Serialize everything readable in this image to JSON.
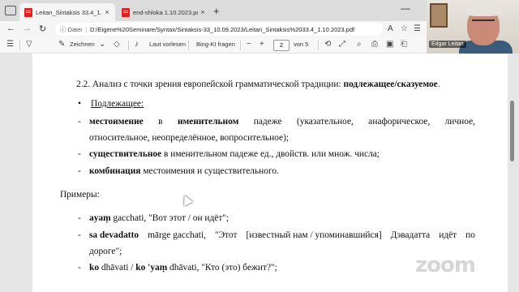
{
  "tabs": [
    {
      "title": "Leitan_Sintaksis 33.4_1.10.2023.p",
      "close": "×",
      "active": true
    },
    {
      "title": "end-shloka 1.10.2023.pdf",
      "close": "×",
      "active": false
    }
  ],
  "new_tab": "+",
  "minimize": "—",
  "nav": {
    "back": "←",
    "forward": "→",
    "reload": "↻"
  },
  "address": {
    "info": "ⓘ Datei",
    "url": "D:/Eigene%20Seminare/Syntax/Sintaksis-33_10.09.2023/Leitan_Sintaksis%2033.4_1.10.2023.pdf"
  },
  "pdf_toolbar": {
    "draw": "Zeichnen",
    "read_aloud": "Laut vorlesen",
    "bing": "Bing-KI fragen",
    "page_current": "2",
    "page_total": "von 5"
  },
  "document": {
    "heading_prefix": "2.2. Анализ с точки зрения европейской грамматической традиции: ",
    "heading_bold": "подлежащее/сказуемое",
    "heading_suffix": ".",
    "subject_bullet": "•",
    "subject_label": "Подлежащее:",
    "items": [
      {
        "dash": "-",
        "bold1": "местоимение",
        "t1": "в",
        "bold2": "именительном",
        "t2": "падеже",
        "t3": "(указательное,",
        "t4": "анафорическое,",
        "t5": "личное,",
        "line2": "относительное, неопределённое, вопросительное);"
      },
      {
        "dash": "-",
        "bold": "существительное",
        "text": " в именительном падеже ед., двойств. или множ. числа;"
      },
      {
        "dash": "-",
        "bold": "комбинация",
        "text": " местоимения и существительного."
      }
    ],
    "examples_label": "Примеры:",
    "examples": [
      {
        "dash": "-",
        "bold": "ayaṃ",
        "text": " gacchati, \"Вот этот / он идёт\";"
      },
      {
        "dash": "-",
        "bold": "sa devadatto",
        "w1": "mārge gacchati,",
        "w2": "\"Этот",
        "w3": "[известный нам / упоминавшийся]",
        "w4": "Дэвадатта",
        "w5": "идёт",
        "w6": "по",
        "line2": "дороге\";"
      },
      {
        "dash": "-",
        "bold1": "ko",
        "t1": " dhāvati / ",
        "bold2": "ko 'yaṃ",
        "t2": " dhāvati, \"Кто (это) бежит?\";"
      }
    ]
  },
  "video": {
    "name": "Edgar Leitan"
  },
  "watermark": "zoom"
}
